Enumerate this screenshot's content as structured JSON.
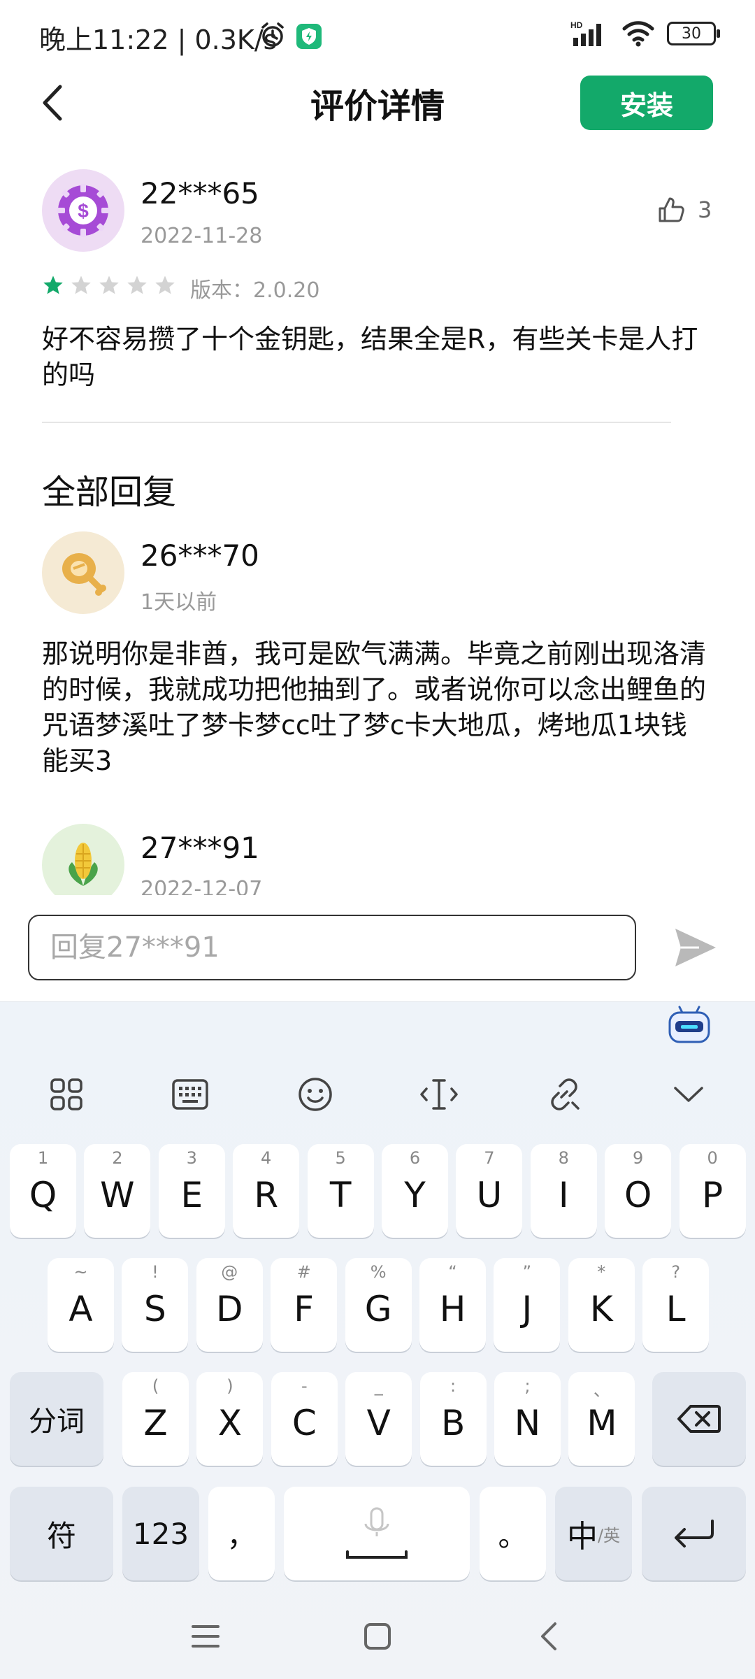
{
  "status_bar": {
    "time": "晚上11:22 | 0.3K/s",
    "battery": "30"
  },
  "header": {
    "title": "评价详情",
    "install_label": "安装"
  },
  "review": {
    "username": "22***65",
    "date": "2022-11-28",
    "likes": "3",
    "rating": 1,
    "rating_max": 5,
    "version": "版本：2.0.20",
    "text": "好不容易攒了十个金钥匙，结果全是R，有些关卡是人打的吗"
  },
  "replies_title": "全部回复",
  "replies": [
    {
      "username": "26***70",
      "date": "1天以前",
      "text": "那说明你是非酋，我可是欧气满满。毕竟之前刚出现洛清的时候，我就成功把他抽到了。或者说你可以念出鲤鱼的咒语梦溪吐了梦卡梦cc吐了梦c卡大地瓜，烤地瓜1块钱能买3"
    },
    {
      "username": "27***91",
      "date": "2022-12-07"
    }
  ],
  "reply_box": {
    "placeholder": "回复27***91"
  },
  "keyboard": {
    "row1": [
      {
        "key": "Q",
        "hint": "1"
      },
      {
        "key": "W",
        "hint": "2"
      },
      {
        "key": "E",
        "hint": "3"
      },
      {
        "key": "R",
        "hint": "4"
      },
      {
        "key": "T",
        "hint": "5"
      },
      {
        "key": "Y",
        "hint": "6"
      },
      {
        "key": "U",
        "hint": "7"
      },
      {
        "key": "I",
        "hint": "8"
      },
      {
        "key": "O",
        "hint": "9"
      },
      {
        "key": "P",
        "hint": "0"
      }
    ],
    "row2": [
      {
        "key": "A",
        "hint": "~"
      },
      {
        "key": "S",
        "hint": "!"
      },
      {
        "key": "D",
        "hint": "@"
      },
      {
        "key": "F",
        "hint": "#"
      },
      {
        "key": "G",
        "hint": "%"
      },
      {
        "key": "H",
        "hint": "“"
      },
      {
        "key": "J",
        "hint": "”"
      },
      {
        "key": "K",
        "hint": "*"
      },
      {
        "key": "L",
        "hint": "?"
      }
    ],
    "row3": [
      {
        "key": "Z",
        "hint": "("
      },
      {
        "key": "X",
        "hint": ")"
      },
      {
        "key": "C",
        "hint": "-"
      },
      {
        "key": "V",
        "hint": "_"
      },
      {
        "key": "B",
        "hint": ":"
      },
      {
        "key": "N",
        "hint": ";"
      },
      {
        "key": "M",
        "hint": "、"
      }
    ],
    "segment_label": "分词",
    "symbol_label": "符",
    "numbers_label": "123",
    "comma_label": "，",
    "period_label": "。",
    "lang_main": "中",
    "lang_sub": "/英"
  }
}
